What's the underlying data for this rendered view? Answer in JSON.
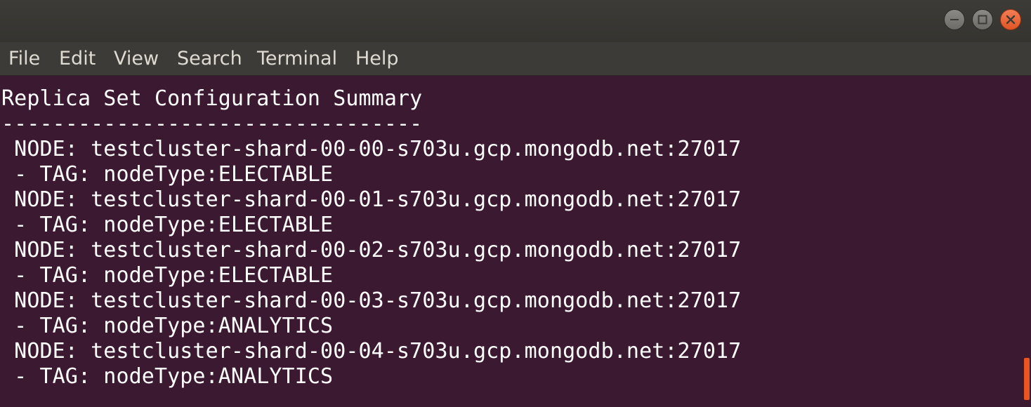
{
  "window": {
    "controls": {
      "minimize_icon": "minimize-icon",
      "maximize_icon": "maximize-icon",
      "close_icon": "close-icon"
    }
  },
  "menu": {
    "items": [
      {
        "label": "File"
      },
      {
        "label": "Edit"
      },
      {
        "label": "View"
      },
      {
        "label": "Search"
      },
      {
        "label": "Terminal"
      },
      {
        "label": "Help"
      }
    ]
  },
  "terminal": {
    "lines": [
      "Replica Set Configuration Summary",
      "---------------------------------",
      " NODE: testcluster-shard-00-00-s703u.gcp.mongodb.net:27017",
      " - TAG: nodeType:ELECTABLE",
      " NODE: testcluster-shard-00-01-s703u.gcp.mongodb.net:27017",
      " - TAG: nodeType:ELECTABLE",
      " NODE: testcluster-shard-00-02-s703u.gcp.mongodb.net:27017",
      " - TAG: nodeType:ELECTABLE",
      " NODE: testcluster-shard-00-03-s703u.gcp.mongodb.net:27017",
      " - TAG: nodeType:ANALYTICS",
      " NODE: testcluster-shard-00-04-s703u.gcp.mongodb.net:27017",
      " - TAG: nodeType:ANALYTICS"
    ]
  },
  "colors": {
    "terminal_bg": "#3b1930",
    "terminal_fg": "#ffffff",
    "chrome_bg": "#3c3b37",
    "close_button": "#e95420",
    "scroll_thumb": "#e95420"
  }
}
